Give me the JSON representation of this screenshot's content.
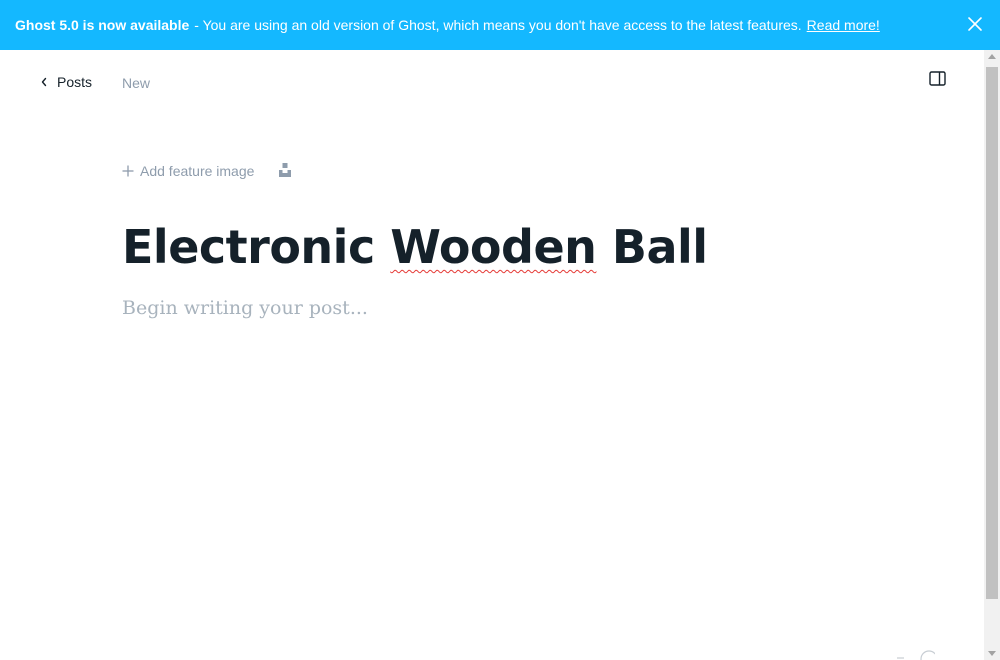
{
  "banner": {
    "headline": "Ghost 5.0 is now available",
    "message": "- You are using an old version of Ghost, which means you don't have access to the latest features.",
    "link_text": "Read more!",
    "background": "#14b8ff",
    "close_icon": "close-icon"
  },
  "nav": {
    "back_label": "Posts",
    "back_icon": "chevron-left-icon",
    "status_label": "New",
    "sidebar_icon": "sidebar-toggle-icon"
  },
  "editor": {
    "add_feature_label": "Add feature image",
    "unsplash_icon": "unsplash-icon",
    "title_before": "Electronic ",
    "title_misspelled": "Wooden",
    "title_after": " Ball",
    "body_placeholder": "Begin writing your post..."
  }
}
